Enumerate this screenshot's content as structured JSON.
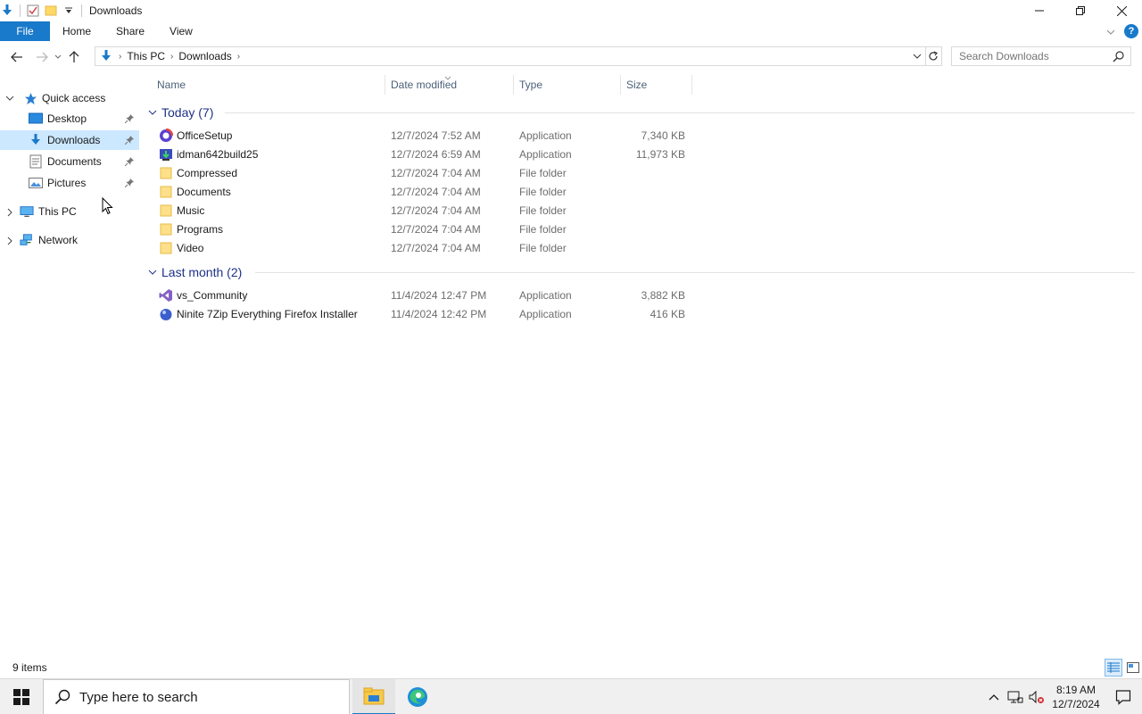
{
  "window": {
    "title": "Downloads"
  },
  "ribbon": {
    "tabs": [
      "File",
      "Home",
      "Share",
      "View"
    ]
  },
  "address": {
    "crumbs": [
      "This PC",
      "Downloads"
    ]
  },
  "search": {
    "placeholder": "Search Downloads"
  },
  "nav": {
    "quick_access": "Quick access",
    "items": [
      {
        "label": "Desktop",
        "icon": "desktop-icon",
        "pinned": true
      },
      {
        "label": "Downloads",
        "icon": "downloads-icon",
        "pinned": true,
        "selected": true
      },
      {
        "label": "Documents",
        "icon": "documents-icon",
        "pinned": true
      },
      {
        "label": "Pictures",
        "icon": "pictures-icon",
        "pinned": true
      }
    ],
    "this_pc": "This PC",
    "network": "Network"
  },
  "columns": [
    "Name",
    "Date modified",
    "Type",
    "Size"
  ],
  "groups": [
    {
      "label": "Today (7)",
      "files": [
        {
          "name": "OfficeSetup",
          "date": "12/7/2024 7:52 AM",
          "type": "Application",
          "size": "7,340 KB",
          "icon": "office-setup-icon"
        },
        {
          "name": "idman642build25",
          "date": "12/7/2024 6:59 AM",
          "type": "Application",
          "size": "11,973 KB",
          "icon": "idm-icon"
        },
        {
          "name": "Compressed",
          "date": "12/7/2024 7:04 AM",
          "type": "File folder",
          "size": "",
          "icon": "folder-icon"
        },
        {
          "name": "Documents",
          "date": "12/7/2024 7:04 AM",
          "type": "File folder",
          "size": "",
          "icon": "folder-icon"
        },
        {
          "name": "Music",
          "date": "12/7/2024 7:04 AM",
          "type": "File folder",
          "size": "",
          "icon": "folder-icon"
        },
        {
          "name": "Programs",
          "date": "12/7/2024 7:04 AM",
          "type": "File folder",
          "size": "",
          "icon": "folder-icon"
        },
        {
          "name": "Video",
          "date": "12/7/2024 7:04 AM",
          "type": "File folder",
          "size": "",
          "icon": "folder-icon"
        }
      ]
    },
    {
      "label": "Last month (2)",
      "files": [
        {
          "name": "vs_Community",
          "date": "11/4/2024 12:47 PM",
          "type": "Application",
          "size": "3,882 KB",
          "icon": "visual-studio-icon"
        },
        {
          "name": "Ninite 7Zip Everything Firefox Installer",
          "date": "11/4/2024 12:42 PM",
          "type": "Application",
          "size": "416 KB",
          "icon": "ninite-icon"
        }
      ]
    }
  ],
  "status": {
    "item_count": "9 items"
  },
  "taskbar": {
    "search_placeholder": "Type here to search",
    "time": "8:19 AM",
    "date": "12/7/2024"
  },
  "colors": {
    "accent": "#1979ca",
    "selection": "#cce8ff",
    "group_header": "#1e3287"
  }
}
